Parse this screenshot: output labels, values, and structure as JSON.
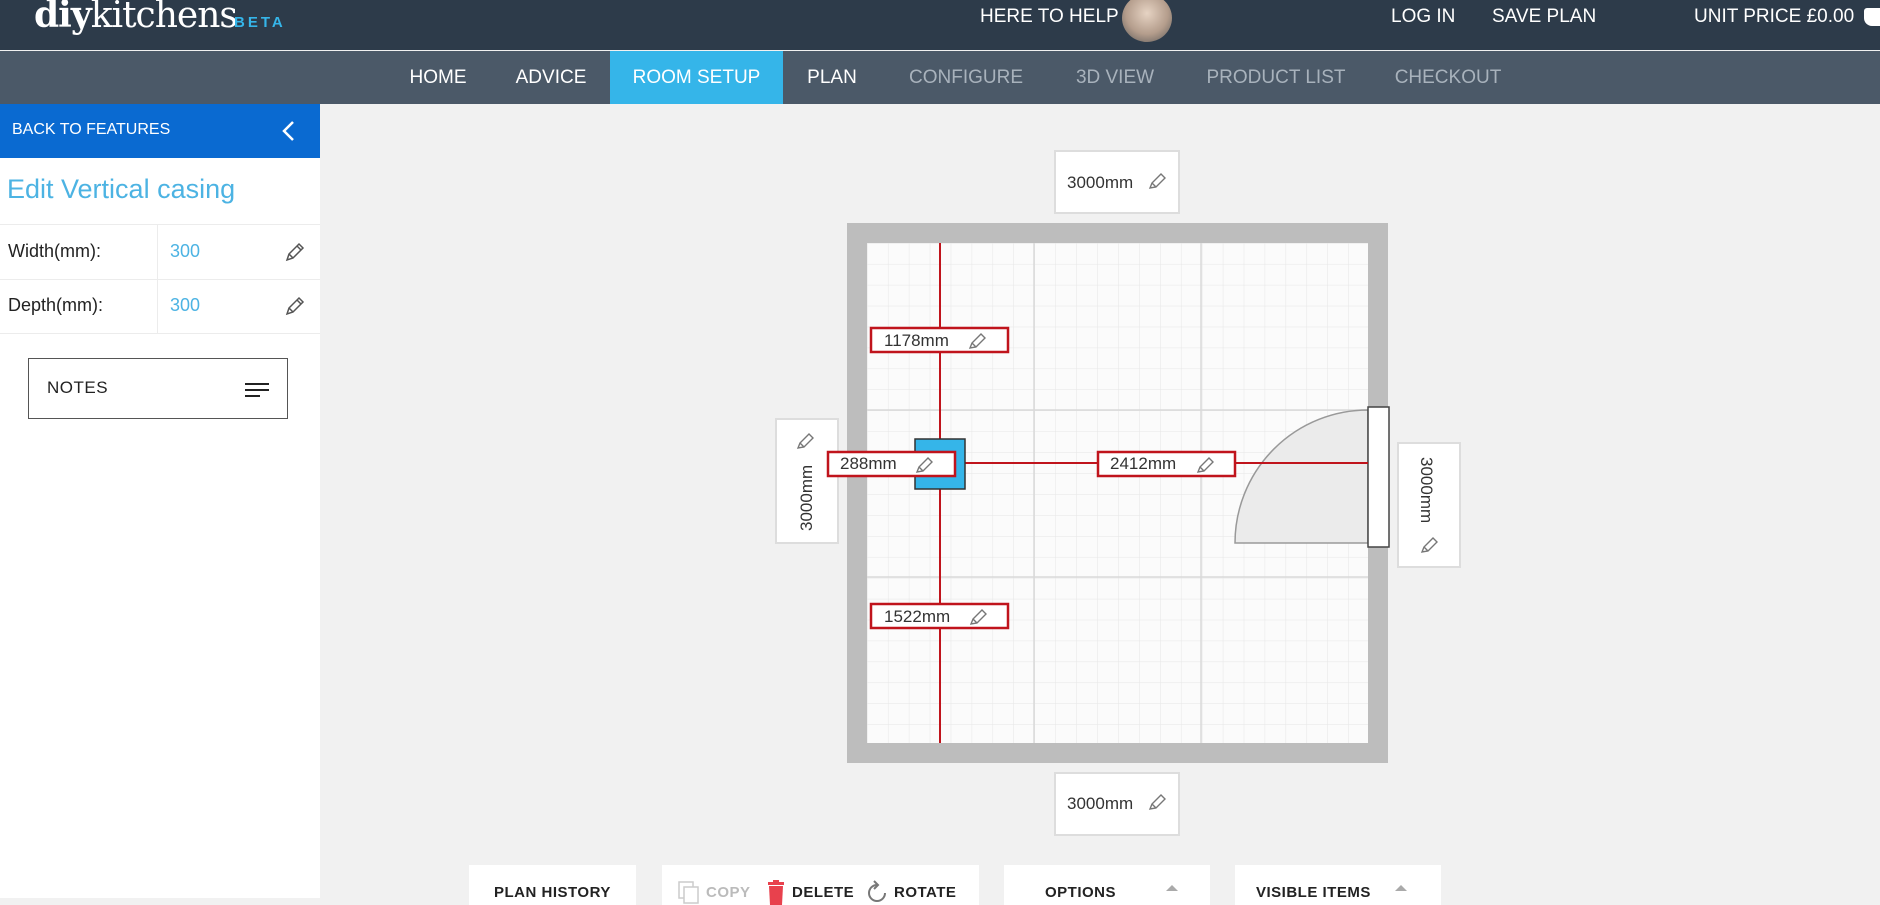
{
  "header": {
    "logo_diy": "diy",
    "logo_kitchens": "kitchens",
    "logo_beta": "BETA",
    "help_text": "HERE TO HELP",
    "login": "LOG IN",
    "save_plan": "SAVE PLAN",
    "unit_price": "UNIT PRICE £0.00"
  },
  "nav": {
    "items": [
      {
        "label": "HOME"
      },
      {
        "label": "ADVICE"
      },
      {
        "label": "ROOM SETUP"
      },
      {
        "label": "PLAN"
      },
      {
        "label": "CONFIGURE"
      },
      {
        "label": "3D VIEW"
      },
      {
        "label": "PRODUCT LIST"
      },
      {
        "label": "CHECKOUT"
      }
    ],
    "active": "ROOM SETUP"
  },
  "sidebar": {
    "back_label": "BACK TO FEATURES",
    "title": "Edit Vertical casing",
    "properties": [
      {
        "label": "Width(mm):",
        "value": "300"
      },
      {
        "label": "Depth(mm):",
        "value": "300"
      }
    ],
    "notes_label": "NOTES"
  },
  "plan": {
    "top_wall": "3000mm",
    "bottom_wall": "3000mm",
    "left_wall": "3000mm",
    "right_wall": "3000mm",
    "dist_top": "1178mm",
    "dist_bottom": "1522mm",
    "dist_left": "288mm",
    "dist_right": "2412mm",
    "casing_color": "#35b5e9",
    "measure_color": "#c0141c"
  },
  "toolbar": {
    "plan_history": "PLAN HISTORY",
    "copy": "COPY",
    "delete": "DELETE",
    "rotate": "ROTATE",
    "options": "OPTIONS",
    "visible_items": "VISIBLE ITEMS"
  }
}
